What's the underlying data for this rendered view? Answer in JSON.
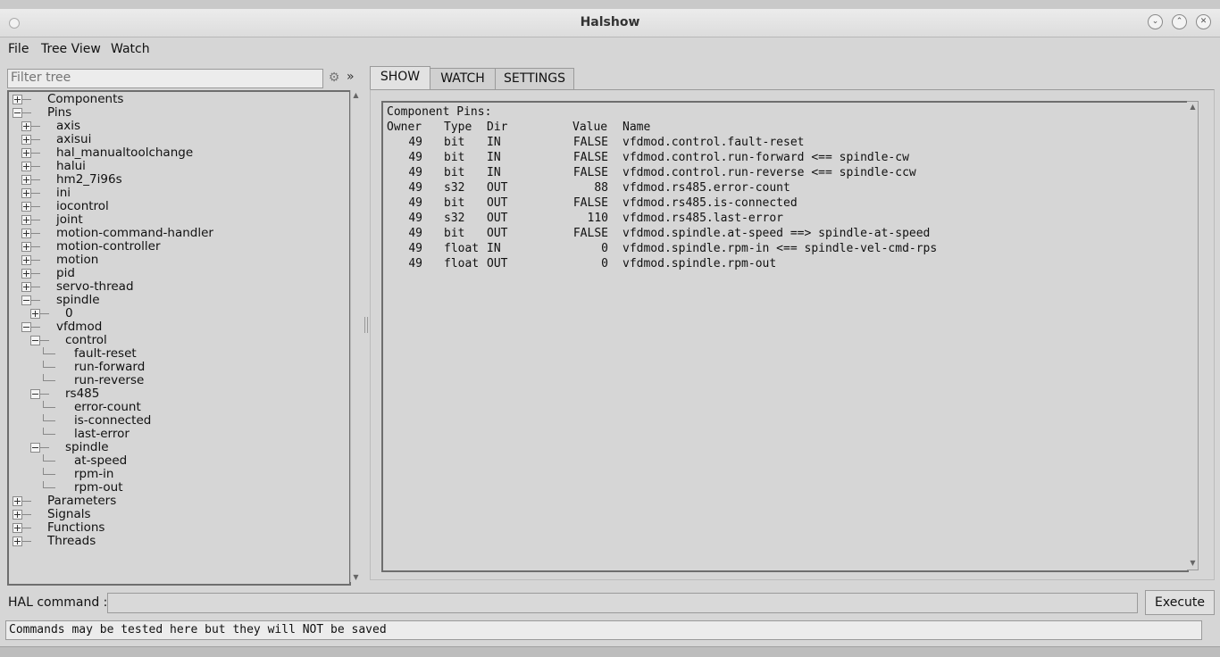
{
  "window": {
    "title": "Halshow"
  },
  "menu": [
    "File",
    "Tree View",
    "Watch"
  ],
  "filter": {
    "placeholder": "Filter tree"
  },
  "tree": [
    {
      "label": "Components",
      "depth": 0,
      "box": "plus"
    },
    {
      "label": "Pins",
      "depth": 0,
      "box": "minus"
    },
    {
      "label": "axis",
      "depth": 1,
      "box": "plus"
    },
    {
      "label": "axisui",
      "depth": 1,
      "box": "plus"
    },
    {
      "label": "hal_manualtoolchange",
      "depth": 1,
      "box": "plus"
    },
    {
      "label": "halui",
      "depth": 1,
      "box": "plus"
    },
    {
      "label": "hm2_7i96s",
      "depth": 1,
      "box": "plus"
    },
    {
      "label": "ini",
      "depth": 1,
      "box": "plus"
    },
    {
      "label": "iocontrol",
      "depth": 1,
      "box": "plus"
    },
    {
      "label": "joint",
      "depth": 1,
      "box": "plus"
    },
    {
      "label": "motion-command-handler",
      "depth": 1,
      "box": "plus"
    },
    {
      "label": "motion-controller",
      "depth": 1,
      "box": "plus"
    },
    {
      "label": "motion",
      "depth": 1,
      "box": "plus"
    },
    {
      "label": "pid",
      "depth": 1,
      "box": "plus"
    },
    {
      "label": "servo-thread",
      "depth": 1,
      "box": "plus"
    },
    {
      "label": "spindle",
      "depth": 1,
      "box": "minus"
    },
    {
      "label": "0",
      "depth": 2,
      "box": "plus"
    },
    {
      "label": "vfdmod",
      "depth": 1,
      "box": "minus"
    },
    {
      "label": "control",
      "depth": 2,
      "box": "minus"
    },
    {
      "label": "fault-reset",
      "depth": 3,
      "box": "leaf"
    },
    {
      "label": "run-forward",
      "depth": 3,
      "box": "leaf"
    },
    {
      "label": "run-reverse",
      "depth": 3,
      "box": "leaf"
    },
    {
      "label": "rs485",
      "depth": 2,
      "box": "minus"
    },
    {
      "label": "error-count",
      "depth": 3,
      "box": "leaf"
    },
    {
      "label": "is-connected",
      "depth": 3,
      "box": "leaf"
    },
    {
      "label": "last-error",
      "depth": 3,
      "box": "leaf"
    },
    {
      "label": "spindle",
      "depth": 2,
      "box": "minus"
    },
    {
      "label": "at-speed",
      "depth": 3,
      "box": "leaf"
    },
    {
      "label": "rpm-in",
      "depth": 3,
      "box": "leaf"
    },
    {
      "label": "rpm-out",
      "depth": 3,
      "box": "leaf"
    },
    {
      "label": "Parameters",
      "depth": 0,
      "box": "plus"
    },
    {
      "label": "Signals",
      "depth": 0,
      "box": "plus"
    },
    {
      "label": "Functions",
      "depth": 0,
      "box": "plus"
    },
    {
      "label": "Threads",
      "depth": 0,
      "box": "plus"
    }
  ],
  "tabs": [
    "SHOW",
    "WATCH",
    "SETTINGS"
  ],
  "active_tab": "SHOW",
  "show": {
    "heading": "Component Pins:",
    "columns": [
      "Owner",
      "Type",
      "Dir",
      "Value",
      "Name"
    ],
    "rows": [
      [
        "49",
        "bit",
        "IN",
        "FALSE",
        "vfdmod.control.fault-reset"
      ],
      [
        "49",
        "bit",
        "IN",
        "FALSE",
        "vfdmod.control.run-forward <== spindle-cw"
      ],
      [
        "49",
        "bit",
        "IN",
        "FALSE",
        "vfdmod.control.run-reverse <== spindle-ccw"
      ],
      [
        "49",
        "s32",
        "OUT",
        "88",
        "vfdmod.rs485.error-count"
      ],
      [
        "49",
        "bit",
        "OUT",
        "FALSE",
        "vfdmod.rs485.is-connected"
      ],
      [
        "49",
        "s32",
        "OUT",
        "110",
        "vfdmod.rs485.last-error"
      ],
      [
        "49",
        "bit",
        "OUT",
        "FALSE",
        "vfdmod.spindle.at-speed ==> spindle-at-speed"
      ],
      [
        "49",
        "float",
        "IN",
        "0",
        "vfdmod.spindle.rpm-in <== spindle-vel-cmd-rps"
      ],
      [
        "49",
        "float",
        "OUT",
        "0",
        "vfdmod.spindle.rpm-out"
      ]
    ]
  },
  "hal": {
    "label": "HAL command :",
    "value": "",
    "execute": "Execute"
  },
  "status": "Commands may be tested here but they will NOT be saved"
}
